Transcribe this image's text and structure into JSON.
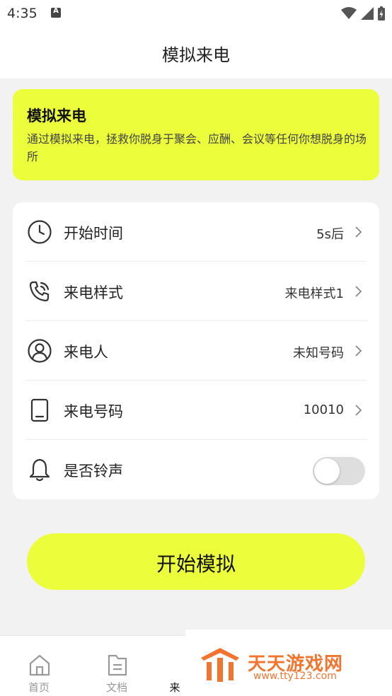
{
  "status_bar": {
    "time": "4:35"
  },
  "header": {
    "title": "模拟来电"
  },
  "banner": {
    "title": "模拟来电",
    "description": "通过模拟来电，拯救你脱身于聚会、应酬、会议等任何你想脱身的场所"
  },
  "settings": {
    "rows": [
      {
        "label": "开始时间",
        "value": "5s后",
        "icon": "clock-icon"
      },
      {
        "label": "来电样式",
        "value": "来电样式1",
        "icon": "phone-call-icon"
      },
      {
        "label": "来电人",
        "value": "未知号码",
        "icon": "user-circle-icon"
      },
      {
        "label": "来电号码",
        "value": "10010",
        "icon": "tablet-icon"
      }
    ],
    "ringtone": {
      "label": "是否铃声",
      "enabled": false,
      "icon": "bell-icon"
    }
  },
  "start_button": {
    "label": "开始模拟"
  },
  "tabbar": {
    "tabs": [
      {
        "label": "首页",
        "icon": "home-icon",
        "active": false
      },
      {
        "label": "文档",
        "icon": "document-icon",
        "active": false
      },
      {
        "label": "来",
        "icon": "",
        "active": true
      }
    ]
  },
  "watermark": {
    "name": "天天游戏网",
    "url": "www.tty123.com",
    "color": "#f2752f"
  },
  "colors": {
    "accent": "#ecfd3c",
    "background": "#f2f2f2"
  }
}
